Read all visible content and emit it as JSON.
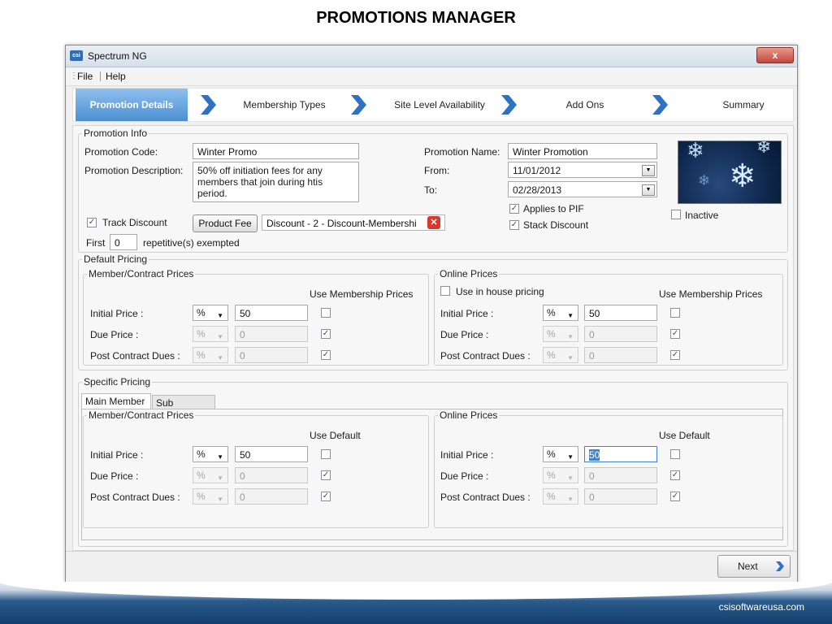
{
  "slide": {
    "title": "PROMOTIONS MANAGER",
    "footer": "csisoftwareusa.com"
  },
  "window": {
    "title": "Spectrum NG",
    "icon": "app-icon",
    "close": "x"
  },
  "menu": {
    "items": [
      "File",
      "Help"
    ]
  },
  "wizard": {
    "steps": [
      "Promotion Details",
      "Membership Types",
      "Site Level Availability",
      "Add Ons",
      "Summary"
    ],
    "active": "Promotion Details"
  },
  "promo_info": {
    "legend": "Promotion Info",
    "code_label": "Promotion Code:",
    "code_value": "Winter Promo",
    "desc_label": "Promotion Description:",
    "desc_value": "50% off initiation fees for any members that join during htis period.",
    "name_label": "Promotion Name:",
    "name_value": "Winter Promotion",
    "from_label": "From:",
    "from_value": "11/01/2012",
    "to_label": "To:",
    "to_value": "02/28/2013",
    "applies_pif": "Applies to PIF",
    "stack_discount": "Stack Discount",
    "inactive": "Inactive",
    "track_discount": "Track Discount",
    "product_fee": "Product Fee",
    "discount_value": "Discount - 2 - Discount-Membershi",
    "first_label": "First",
    "first_value": "0",
    "exempted_label": "repetitive(s) exempted"
  },
  "default_pricing": {
    "legend": "Default Pricing",
    "member": {
      "legend": "Member/Contract Prices",
      "use_label": "Use Membership Prices",
      "rows": [
        {
          "label": "Initial Price :",
          "unit": "%",
          "value": "50",
          "enabled": true,
          "checked": false
        },
        {
          "label": "Due Price :",
          "unit": "%",
          "value": "0",
          "enabled": false,
          "checked": true
        },
        {
          "label": "Post Contract Dues :",
          "unit": "%",
          "value": "0",
          "enabled": false,
          "checked": true
        }
      ]
    },
    "online": {
      "legend": "Online Prices",
      "in_house": "Use in house pricing",
      "use_label": "Use Membership Prices",
      "rows": [
        {
          "label": "Initial Price :",
          "unit": "%",
          "value": "50",
          "enabled": true,
          "checked": false
        },
        {
          "label": "Due Price :",
          "unit": "%",
          "value": "0",
          "enabled": false,
          "checked": true
        },
        {
          "label": "Post Contract Dues :",
          "unit": "%",
          "value": "0",
          "enabled": false,
          "checked": true
        }
      ]
    }
  },
  "specific_pricing": {
    "legend": "Specific Pricing",
    "tabs": [
      "Main Member",
      "Sub Member"
    ],
    "member": {
      "legend": "Member/Contract Prices",
      "use_label": "Use Default",
      "rows": [
        {
          "label": "Initial Price :",
          "unit": "%",
          "value": "50",
          "enabled": true,
          "checked": false
        },
        {
          "label": "Due Price :",
          "unit": "%",
          "value": "0",
          "enabled": false,
          "checked": true
        },
        {
          "label": "Post Contract Dues :",
          "unit": "%",
          "value": "0",
          "enabled": false,
          "checked": true
        }
      ]
    },
    "online": {
      "legend": "Online Prices",
      "use_label": "Use Default",
      "rows": [
        {
          "label": "Initial Price :",
          "unit": "%",
          "value": "50",
          "enabled": true,
          "checked": false
        },
        {
          "label": "Due Price :",
          "unit": "%",
          "value": "0",
          "enabled": false,
          "checked": true
        },
        {
          "label": "Post Contract Dues :",
          "unit": "%",
          "value": "0",
          "enabled": false,
          "checked": true
        }
      ]
    }
  },
  "footer": {
    "next": "Next"
  },
  "colors": {
    "accent": "#4b8fd2",
    "chevron": "#2f72c4",
    "close": "#c4463a"
  }
}
